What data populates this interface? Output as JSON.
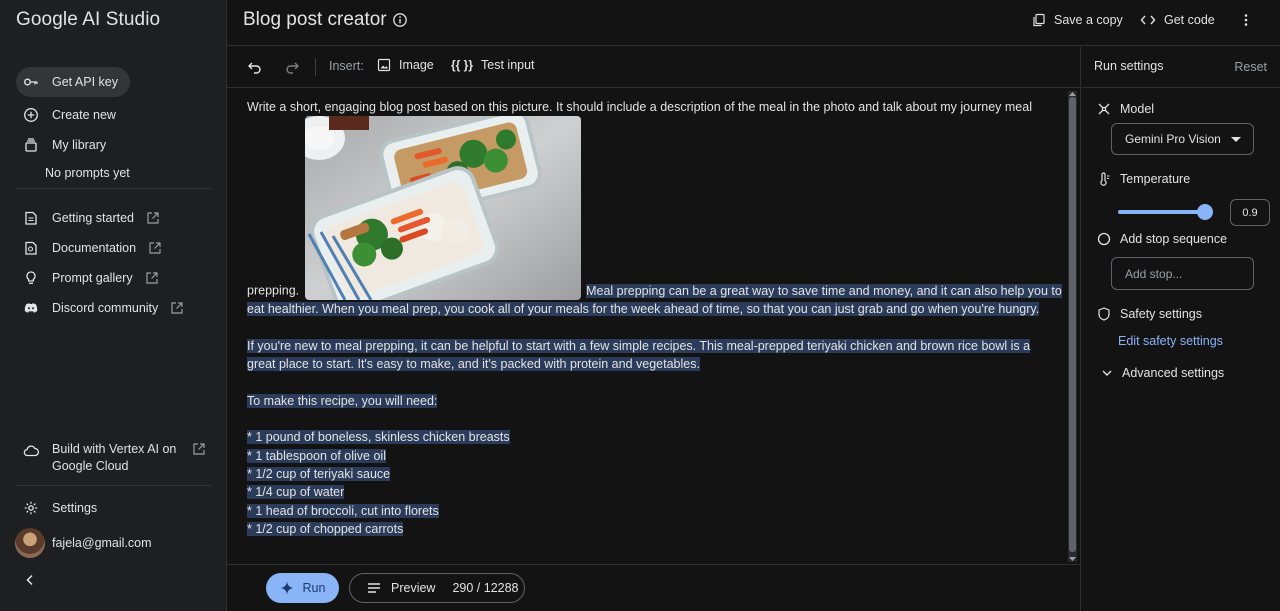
{
  "sidebar": {
    "brand": "Google AI Studio",
    "get_api_key": "Get API key",
    "create_new": "Create new",
    "my_library": "My library",
    "no_prompts": "No prompts yet",
    "getting_started": "Getting started",
    "documentation": "Documentation",
    "prompt_gallery": "Prompt gallery",
    "discord": "Discord community",
    "vertex": "Build with Vertex AI on Google Cloud",
    "settings": "Settings",
    "email": "fajela@gmail.com"
  },
  "header": {
    "title": "Blog post creator",
    "save_copy": "Save a copy",
    "get_code": "Get code"
  },
  "toolbar": {
    "insert_label": "Insert:",
    "image": "Image",
    "test_input_glyph": "{{ }}",
    "test_input": "Test input"
  },
  "editor": {
    "prompt_start": "Write a short, engaging blog post based on this picture. It should include a description of the meal in the photo and talk about my journey meal prepping.",
    "paragraph1": "Meal prepping can be a great way to save time and money, and it can also help you to eat healthier. When you meal prep, you cook all of your meals for the week ahead of time, so that you can just grab and go when you're hungry.",
    "paragraph2": "If you're new to meal prepping, it can be helpful to start with a few simple recipes. This meal-prepped teriyaki chicken and brown rice bowl is a great place to start. It's easy to make, and it's packed with protein and vegetables.",
    "paragraph3": "To make this recipe, you will need:",
    "ingredients": [
      "* 1 pound of boneless, skinless chicken breasts",
      "* 1 tablespoon of olive oil",
      "* 1/2 cup of teriyaki sauce",
      "* 1/4 cup of water",
      "* 1 head of broccoli, cut into florets",
      "* 1/2 cup of chopped carrots"
    ]
  },
  "bottom": {
    "run": "Run",
    "preview": "Preview",
    "token_count": "290 / 12288"
  },
  "run_settings": {
    "title": "Run settings",
    "reset": "Reset",
    "model_label": "Model",
    "model_value": "Gemini Pro Vision",
    "temperature_label": "Temperature",
    "temperature_value": "0.9",
    "stop_label": "Add stop sequence",
    "stop_placeholder": "Add stop...",
    "safety_label": "Safety settings",
    "edit_safety": "Edit safety settings",
    "advanced": "Advanced settings"
  },
  "colors": {
    "accent": "#8ab4f8",
    "highlight": "#2b3c5b",
    "background": "#131314",
    "sidebar": "#1e1f20"
  }
}
